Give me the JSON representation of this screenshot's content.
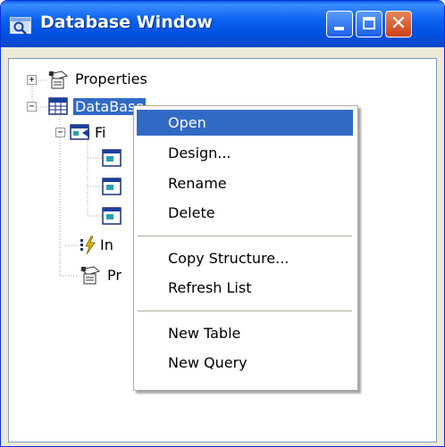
{
  "window": {
    "title": "Database Window",
    "title_icon": "database-window-icon",
    "controls": {
      "minimize": "minimize-icon",
      "maximize": "maximize-icon",
      "close": "close-icon",
      "close_glyph": "✕"
    }
  },
  "tree": {
    "nodes": [
      {
        "label": "Properties",
        "icon": "properties-icon",
        "expander": "+"
      },
      {
        "label": "DataBase",
        "icon": "table-icon",
        "expander": "−",
        "selected": true
      },
      {
        "label": "Fi",
        "icon": "fields-icon",
        "expander": "−"
      },
      {
        "label": "In",
        "icon": "indexes-icon"
      },
      {
        "label": "Pr",
        "icon": "properties-icon"
      }
    ],
    "field_icons": [
      "field-icon",
      "field-icon",
      "field-icon"
    ]
  },
  "context_menu": {
    "items": [
      "Open",
      "Design...",
      "Rename",
      "Delete",
      "Copy Structure...",
      "Refresh List",
      "New Table",
      "New Query"
    ],
    "highlighted": "Open"
  }
}
